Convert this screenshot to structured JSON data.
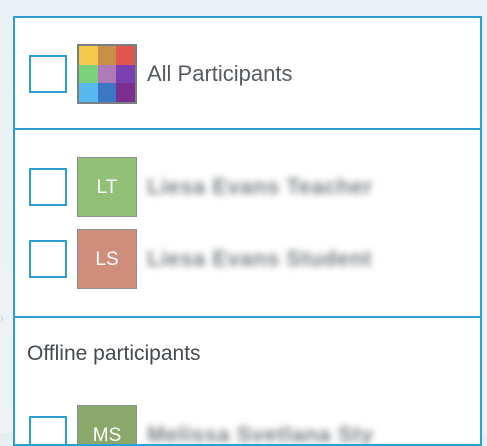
{
  "all_section": {
    "label": "All Participants",
    "mosaic_colors": [
      "#f2c94c",
      "#c98e47",
      "#e0554d",
      "#7bd07a",
      "#b07ab8",
      "#7a3fb0",
      "#58b8f0",
      "#3b77c4",
      "#7a2f8e"
    ]
  },
  "online_section": {
    "participants": [
      {
        "initials": "LT",
        "name": "Liesa Evans Teacher",
        "avatar_color": "#92c076"
      },
      {
        "initials": "LS",
        "name": "Liesa Evans Student",
        "avatar_color": "#cf8e7c"
      }
    ]
  },
  "offline_section": {
    "heading": "Offline participants",
    "participants": [
      {
        "initials": "MS",
        "name": "Melissa Svetlana Sty",
        "avatar_color": "#8aa86c"
      }
    ]
  },
  "colors": {
    "accent_border": "#2aa0d6",
    "text": "#555b60"
  }
}
